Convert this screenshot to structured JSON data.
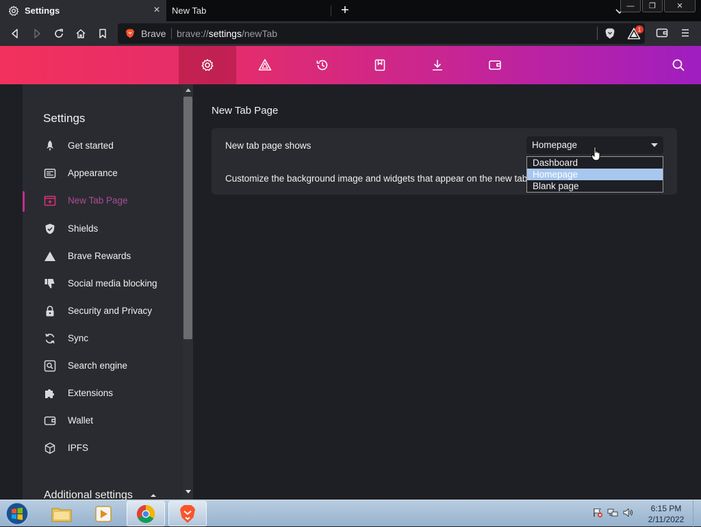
{
  "browser": {
    "tabs": [
      {
        "title": "Settings",
        "active": true
      },
      {
        "title": "New Tab",
        "active": false
      }
    ],
    "window_controls": {
      "minimize": "—",
      "restore": "❐",
      "close": "✕"
    },
    "address_bar": {
      "brand": "Brave",
      "url_scheme": "brave://",
      "url_host": "settings",
      "url_path": "/newTab"
    },
    "rewards_badge": "1"
  },
  "settings_header": {
    "nav_icons": [
      "gear-icon",
      "rewards-triangle-icon",
      "history-icon",
      "bookmarks-icon",
      "downloads-icon",
      "wallet-icon"
    ],
    "search_icon": "search-icon",
    "accent_gradient": [
      "#f2315c",
      "#9f1ec0"
    ]
  },
  "sidebar": {
    "title": "Settings",
    "items": [
      {
        "label": "Get started",
        "icon": "rocket-icon"
      },
      {
        "label": "Appearance",
        "icon": "appearance-icon"
      },
      {
        "label": "New Tab Page",
        "icon": "new-tab-icon",
        "active": true
      },
      {
        "label": "Shields",
        "icon": "shield-icon"
      },
      {
        "label": "Brave Rewards",
        "icon": "rewards-triangle-icon"
      },
      {
        "label": "Social media blocking",
        "icon": "thumbs-down-icon"
      },
      {
        "label": "Security and Privacy",
        "icon": "lock-icon"
      },
      {
        "label": "Sync",
        "icon": "sync-icon"
      },
      {
        "label": "Search engine",
        "icon": "search-engine-icon"
      },
      {
        "label": "Extensions",
        "icon": "puzzle-icon"
      },
      {
        "label": "Wallet",
        "icon": "wallet-icon"
      },
      {
        "label": "IPFS",
        "icon": "cube-icon"
      }
    ],
    "additional": "Additional settings",
    "active_color": "#a94d96"
  },
  "main": {
    "section_title": "New Tab Page",
    "setting_label": "New tab page shows",
    "setting_description": "Customize the background image and widgets that appear on the new tab page",
    "select": {
      "value": "Homepage",
      "options": [
        "Dashboard",
        "Homepage",
        "Blank page"
      ],
      "highlighted": "Homepage"
    }
  },
  "taskbar": {
    "apps": [
      "windows-explorer-icon",
      "media-player-icon",
      "chrome-icon",
      "brave-icon"
    ],
    "clock_time": "6:15 PM",
    "clock_date": "2/11/2022"
  }
}
